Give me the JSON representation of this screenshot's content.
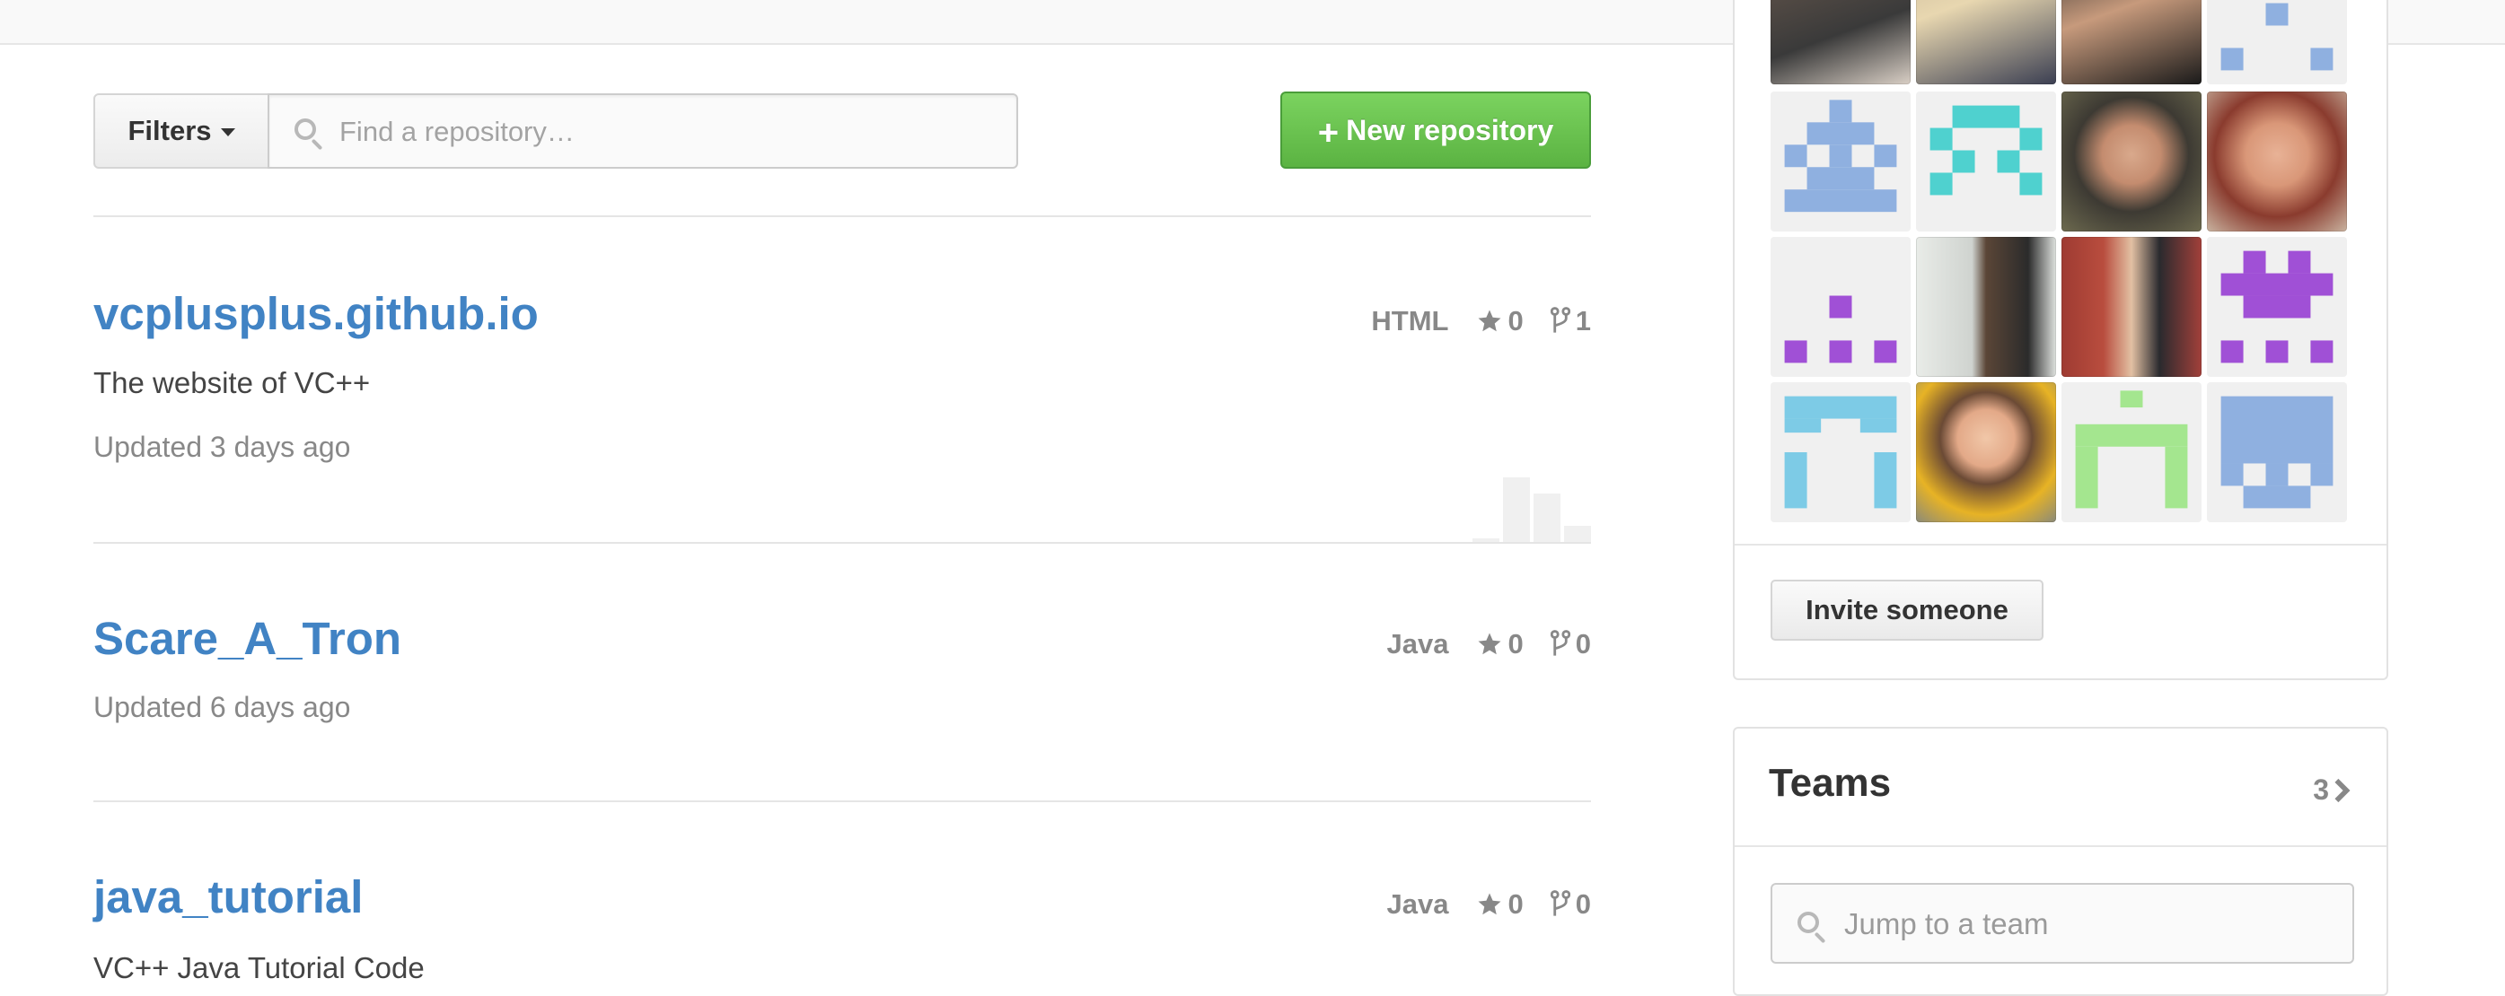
{
  "toolbar": {
    "filters_label": "Filters",
    "search_placeholder": "Find a repository…",
    "new_repo_plus": "+",
    "new_repo_label": "New repository"
  },
  "repos": [
    {
      "name": "vcplusplus.github.io",
      "description": "The website of VC++",
      "updated": "Updated 3 days ago",
      "language": "HTML",
      "stars": "0",
      "forks": "1"
    },
    {
      "name": "Scare_A_Tron",
      "description": "",
      "updated": "Updated 6 days ago",
      "language": "Java",
      "stars": "0",
      "forks": "0"
    },
    {
      "name": "java_tutorial",
      "description": "VC++ Java Tutorial Code",
      "updated": "",
      "language": "Java",
      "stars": "0",
      "forks": "0"
    }
  ],
  "members": {
    "invite_label": "Invite someone"
  },
  "teams": {
    "title": "Teams",
    "count": "3",
    "search_placeholder": "Jump to a team"
  },
  "colors": {
    "link": "#4183c4",
    "green_button": "#5bb342",
    "identicon_blue": "#8fb0e0",
    "identicon_teal": "#4fd1cf",
    "identicon_purple": "#a050d6",
    "identicon_cyan": "#7dcbe6",
    "identicon_green": "#a4e68f"
  },
  "icons": [
    "search-icon",
    "caret-down-icon",
    "plus-icon",
    "star-icon",
    "fork-icon",
    "chevron-right-icon"
  ]
}
